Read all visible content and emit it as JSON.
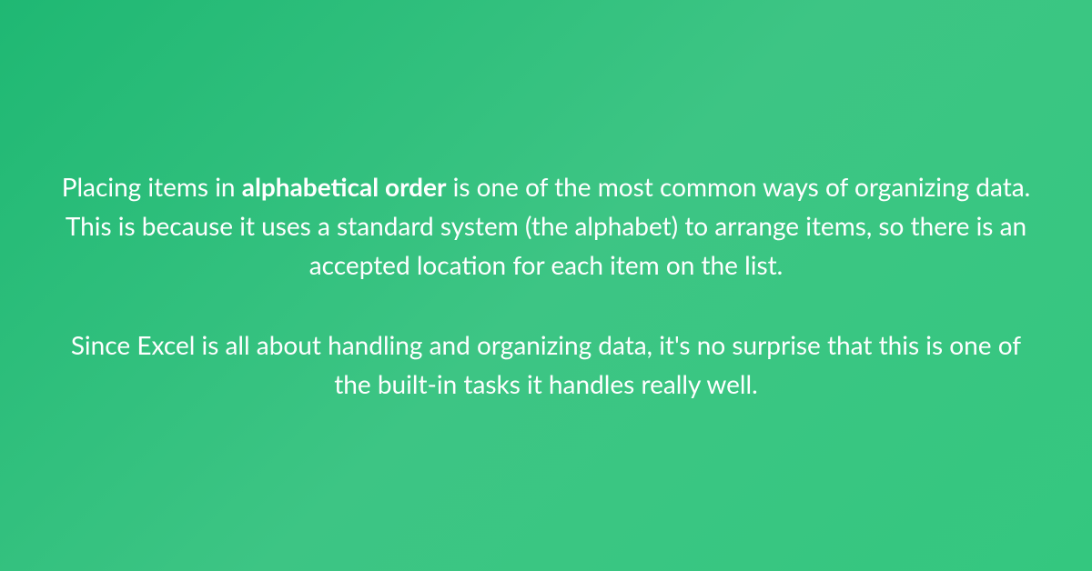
{
  "content": {
    "p1_part1": "Placing items in ",
    "p1_bold": "alphabetical order",
    "p1_part2": " is one of the most common ways of organizing data. This is because it uses a standard system (the alphabet) to arrange items, so there is an accepted location for each item on the list.",
    "p2": "Since Excel is all about handling and organizing data, it's no surprise that this is one of the built-in tasks it handles really well."
  }
}
